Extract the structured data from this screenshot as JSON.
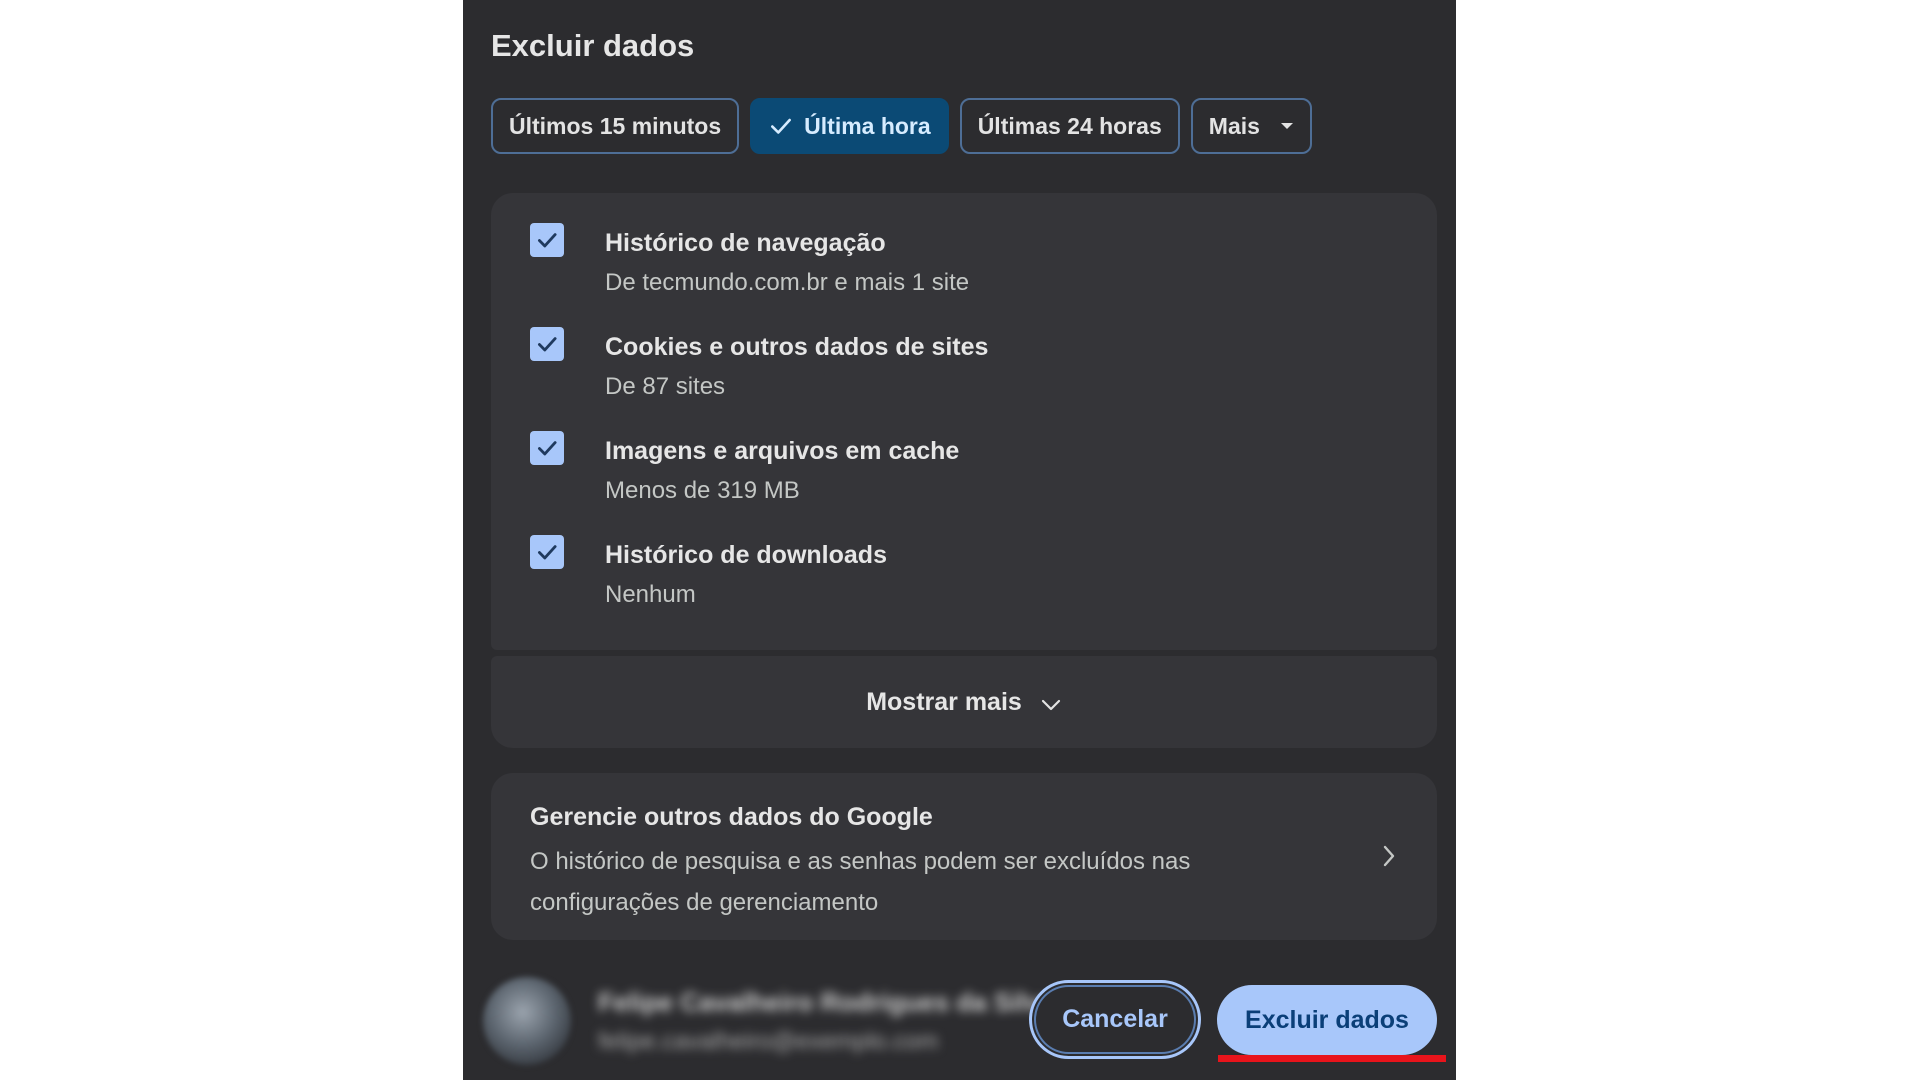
{
  "dialog": {
    "title": "Excluir dados"
  },
  "time_range": {
    "options": [
      {
        "label": "Últimos 15 minutos",
        "selected": false
      },
      {
        "label": "Última hora",
        "selected": true
      },
      {
        "label": "Últimas 24 horas",
        "selected": false
      },
      {
        "label": "Mais",
        "selected": false
      }
    ]
  },
  "items": [
    {
      "title": "Histórico de navegação",
      "subtitle": "De tecmundo.com.br e mais 1 site",
      "checked": true
    },
    {
      "title": "Cookies e outros dados de sites",
      "subtitle": "De 87 sites",
      "checked": true
    },
    {
      "title": "Imagens e arquivos em cache",
      "subtitle": "Menos de 319 MB",
      "checked": true
    },
    {
      "title": "Histórico de downloads",
      "subtitle": "Nenhum",
      "checked": true
    }
  ],
  "show_more": {
    "label": "Mostrar mais"
  },
  "google": {
    "title": "Gerencie outros dados do Google",
    "description": "O histórico de pesquisa e as senhas podem ser excluídos nas configurações de gerenciamento"
  },
  "account": {
    "name": "Felipe Cavalheiro Rodrigues da Silva",
    "email": "felipe.cavalheiro@exemplo.com"
  },
  "buttons": {
    "cancel": "Cancelar",
    "delete": "Excluir dados"
  },
  "colors": {
    "dialog_bg": "#2c2c2f",
    "accent": "#a8c7fa",
    "selected_chip": "#0b4a75",
    "highlight": "#e8141b"
  },
  "icons": {
    "check": "checkmark-icon",
    "caret": "caret-down-icon",
    "chevron_down": "chevron-down-icon",
    "chevron_right": "chevron-right-icon"
  }
}
